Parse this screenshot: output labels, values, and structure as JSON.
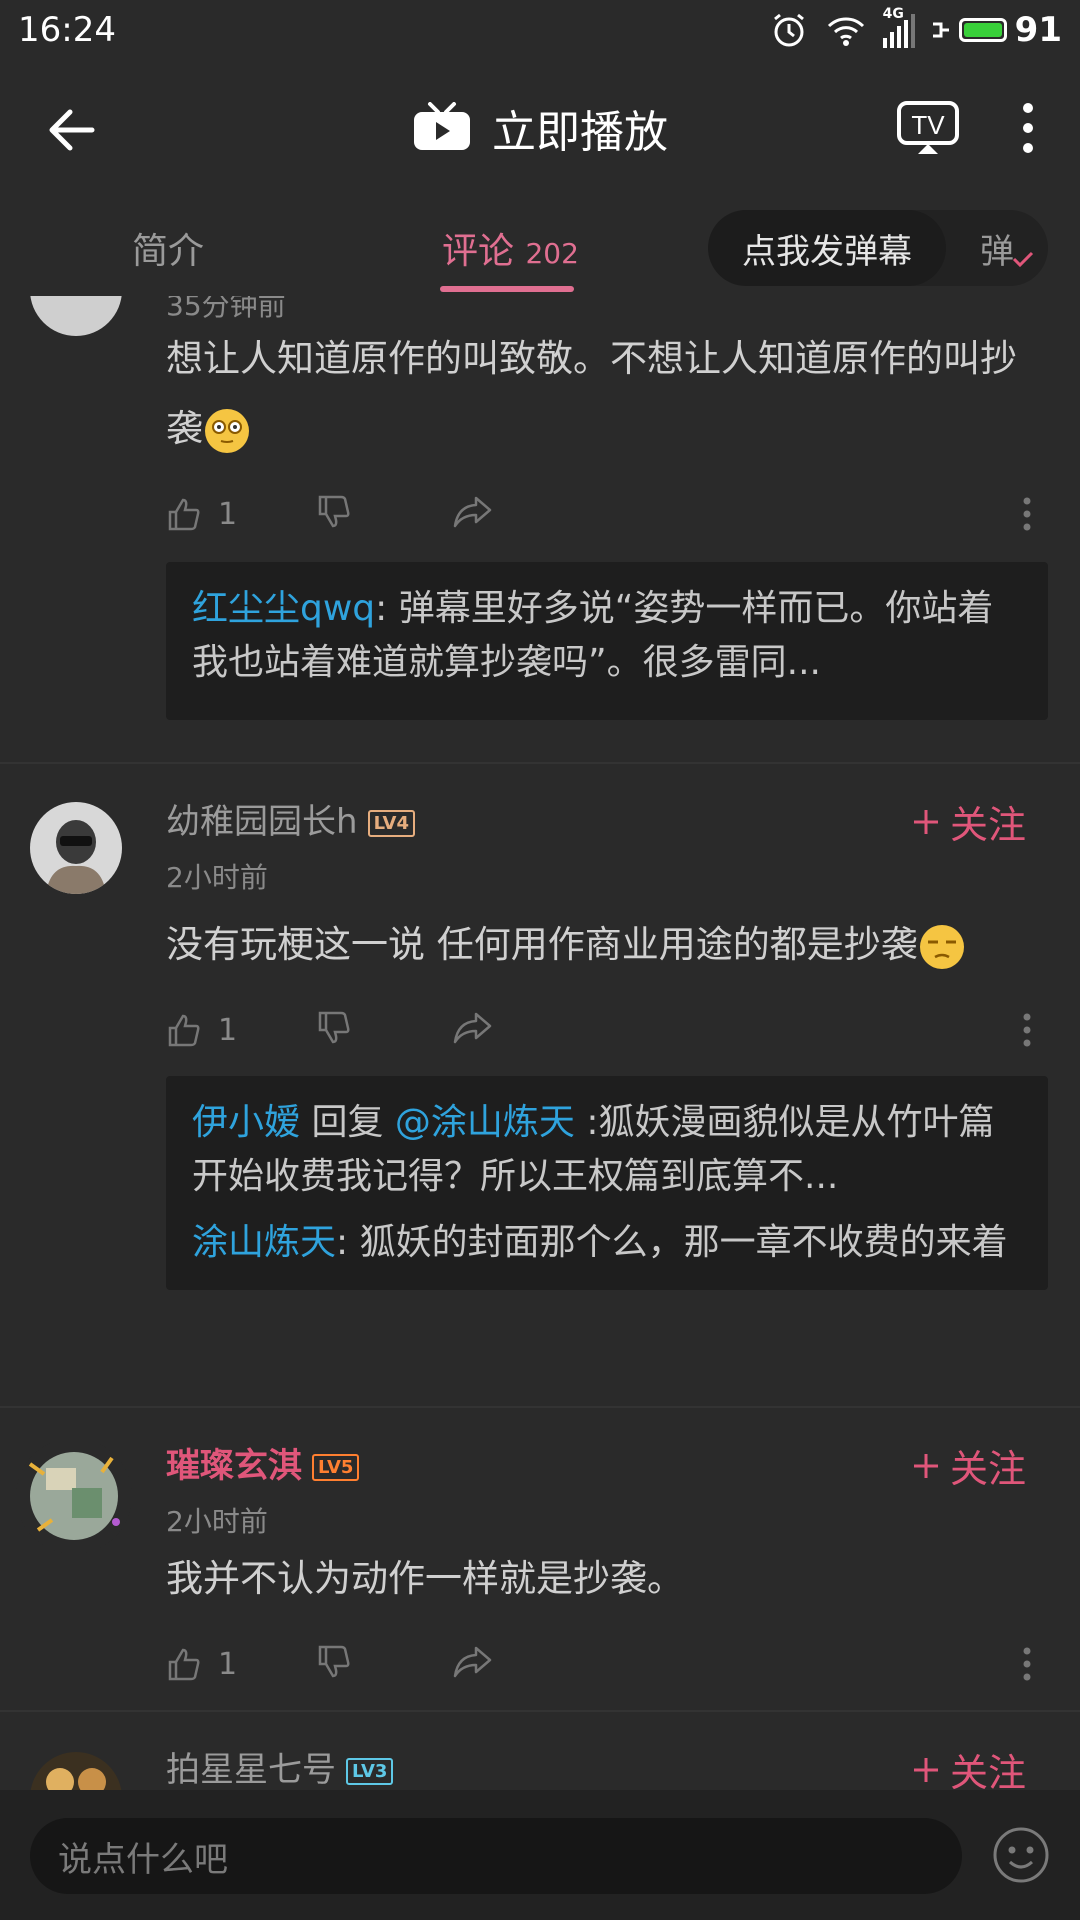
{
  "status_bar": {
    "time": "16:24",
    "network": "4G",
    "battery": "91"
  },
  "header": {
    "title": "立即播放"
  },
  "tabs": {
    "intro": "简介",
    "comments_label": "评论",
    "comments_count": "202",
    "send_danmaku": "点我发弹幕",
    "danmaku_toggle": "弹"
  },
  "comments": [
    {
      "time": "35分钟前",
      "text": "想让人知道原作的叫致敬。不想让人知道原作的叫抄袭",
      "likes": "1",
      "replies": [
        {
          "user": "红尘尘qwq",
          "text": ": 弹幕里好多说“姿势一样而已。你站着我也站着难道就算抄袭吗”。很多雷同..."
        }
      ]
    },
    {
      "user": "幼稚园园长h",
      "level": "LV4",
      "time": "2小时前",
      "follow": "关注",
      "text": "没有玩梗这一说 任何用作商业用途的都是抄袭",
      "likes": "1",
      "replies": [
        {
          "user": "伊小嫒",
          "mid": " 回复 ",
          "target": "@涂山炼天",
          "text": " :狐妖漫画貌似是从竹叶篇开始收费我记得？所以王权篇到底算不..."
        },
        {
          "user": "涂山炼天",
          "text": ": 狐妖的封面那个么，那一章不收费的来着"
        }
      ]
    },
    {
      "user": "璀璨玄淇",
      "level": "LV5",
      "time": "2小时前",
      "follow": "关注",
      "text": "我并不认为动作一样就是抄袭。",
      "likes": "1"
    },
    {
      "user": "拍星星七号",
      "level": "LV3",
      "follow": "关注"
    }
  ],
  "input": {
    "placeholder": "说点什么吧"
  }
}
